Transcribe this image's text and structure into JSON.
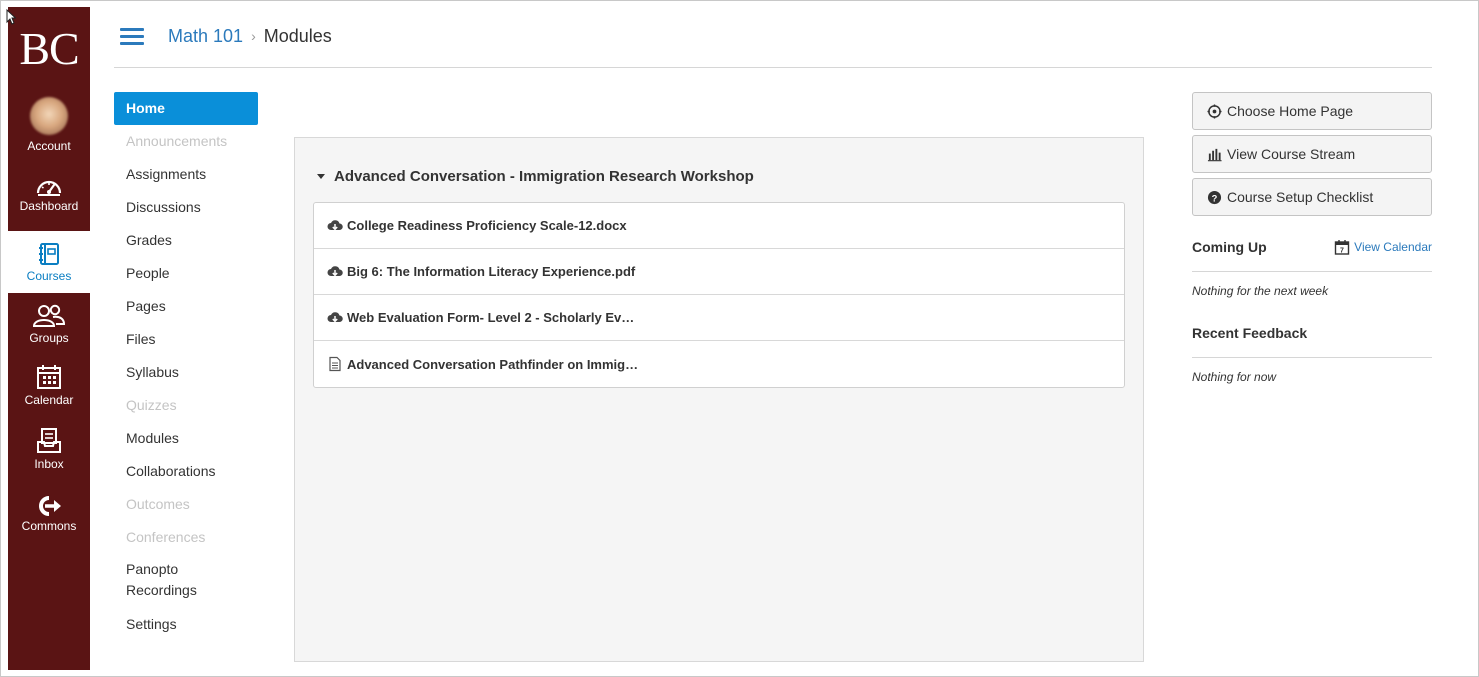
{
  "brand": {
    "logo_text": "BC",
    "nav_bg": "#5a1414",
    "accent": "#0a8fd9",
    "link": "#2b7abc"
  },
  "global_nav": [
    {
      "label": "Account",
      "icon": "avatar"
    },
    {
      "label": "Dashboard",
      "icon": "dashboard-icon"
    },
    {
      "label": "Courses",
      "icon": "courses-icon",
      "active": true
    },
    {
      "label": "Groups",
      "icon": "groups-icon"
    },
    {
      "label": "Calendar",
      "icon": "calendar-icon"
    },
    {
      "label": "Inbox",
      "icon": "inbox-icon"
    },
    {
      "label": "Commons",
      "icon": "commons-icon"
    }
  ],
  "breadcrumb": {
    "course": "Math 101",
    "separator": "›",
    "current": "Modules"
  },
  "course_nav": [
    {
      "label": "Home",
      "state": "active"
    },
    {
      "label": "Announcements",
      "state": "disabled"
    },
    {
      "label": "Assignments",
      "state": "normal"
    },
    {
      "label": "Discussions",
      "state": "normal"
    },
    {
      "label": "Grades",
      "state": "normal"
    },
    {
      "label": "People",
      "state": "normal"
    },
    {
      "label": "Pages",
      "state": "normal"
    },
    {
      "label": "Files",
      "state": "normal"
    },
    {
      "label": "Syllabus",
      "state": "normal"
    },
    {
      "label": "Quizzes",
      "state": "disabled"
    },
    {
      "label": "Modules",
      "state": "normal"
    },
    {
      "label": "Collaborations",
      "state": "normal"
    },
    {
      "label": "Outcomes",
      "state": "disabled"
    },
    {
      "label": "Conferences",
      "state": "disabled"
    },
    {
      "label": "Panopto Recordings",
      "line1": "Panopto",
      "line2": "Recordings",
      "state": "normal"
    },
    {
      "label": "Settings",
      "state": "normal"
    }
  ],
  "module": {
    "title": "Advanced Conversation - Immigration Research Workshop",
    "items": [
      {
        "title": "College Readiness Proficiency Scale-12.docx",
        "icon": "download-cloud-icon"
      },
      {
        "title": "Big 6: The Information Literacy Experience.pdf",
        "icon": "download-cloud-icon"
      },
      {
        "title": "Web Evaluation Form- Level 2 - Scholarly Ev…",
        "icon": "download-cloud-icon"
      },
      {
        "title": "Advanced Conversation Pathfinder on Immig…",
        "icon": "page-icon"
      }
    ]
  },
  "sidebar": {
    "buttons": [
      {
        "label": "Choose Home Page",
        "icon": "target-icon"
      },
      {
        "label": "View Course Stream",
        "icon": "stream-bars-icon"
      },
      {
        "label": "Course Setup Checklist",
        "icon": "help-circle-icon"
      }
    ],
    "coming_up": {
      "title": "Coming Up",
      "link": "View Calendar",
      "empty": "Nothing for the next week"
    },
    "recent_feedback": {
      "title": "Recent Feedback",
      "empty": "Nothing for now"
    }
  }
}
